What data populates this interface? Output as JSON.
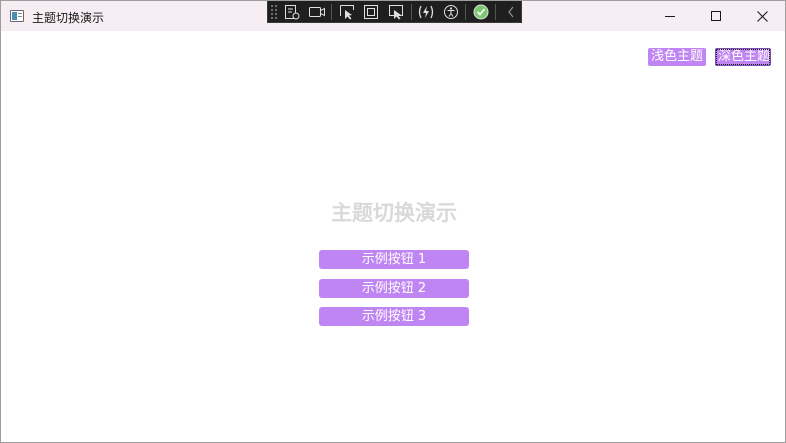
{
  "window": {
    "title": "主题切换演示"
  },
  "debug_toolbar": {
    "icons": [
      "grip-icon",
      "live-visual-tree-icon",
      "record-icon",
      "select-element-icon",
      "display-layout-adorners-icon",
      "track-focus-icon",
      "hot-reload-icon",
      "accessibility-icon",
      "binding-check-icon",
      "collapse-icon"
    ],
    "check_color": "#7bc96f"
  },
  "theme_buttons": {
    "light_label": "浅色主题",
    "dark_label": "深色主题"
  },
  "main": {
    "heading": "主题切换演示",
    "buttons": [
      {
        "label": "示例按钮 1"
      },
      {
        "label": "示例按钮 2"
      },
      {
        "label": "示例按钮 3"
      }
    ]
  },
  "colors": {
    "accent": "#bf85f2",
    "heading": "#d9d9d9",
    "titlebar": "#f6eef3"
  }
}
